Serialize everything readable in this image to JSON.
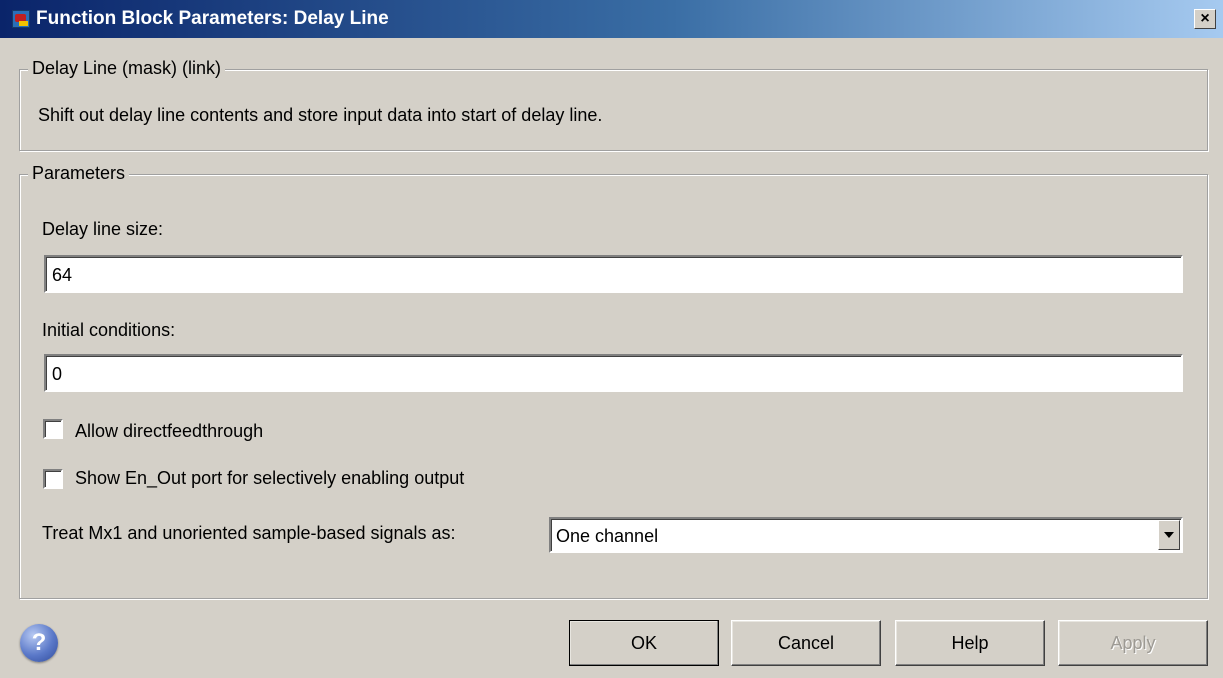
{
  "window": {
    "title": "Function Block Parameters: Delay Line",
    "close_label": "×"
  },
  "block_group": {
    "legend": "Delay Line (mask) (link)",
    "description": "Shift out delay line contents and store input data into start of delay line."
  },
  "parameters_group": {
    "legend": "Parameters",
    "delay_line_size": {
      "label": "Delay line size:",
      "value": "64"
    },
    "initial_conditions": {
      "label": "Initial conditions:",
      "value": "0"
    },
    "allow_directfeedthrough": {
      "label": "Allow directfeedthrough",
      "checked": false
    },
    "show_en_out": {
      "label": "Show En_Out port for selectively enabling output",
      "checked": false
    },
    "treat_signals": {
      "label": "Treat Mx1 and unoriented sample-based signals as:",
      "selected": "One channel"
    }
  },
  "footer": {
    "help_icon": "?",
    "buttons": {
      "ok": "OK",
      "cancel": "Cancel",
      "help": "Help",
      "apply": "Apply"
    }
  },
  "icons": {
    "app_icon": "simulink-block-icon",
    "help_icon": "question-icon",
    "close_icon": "close-icon",
    "dropdown_icon": "chevron-down-icon"
  }
}
